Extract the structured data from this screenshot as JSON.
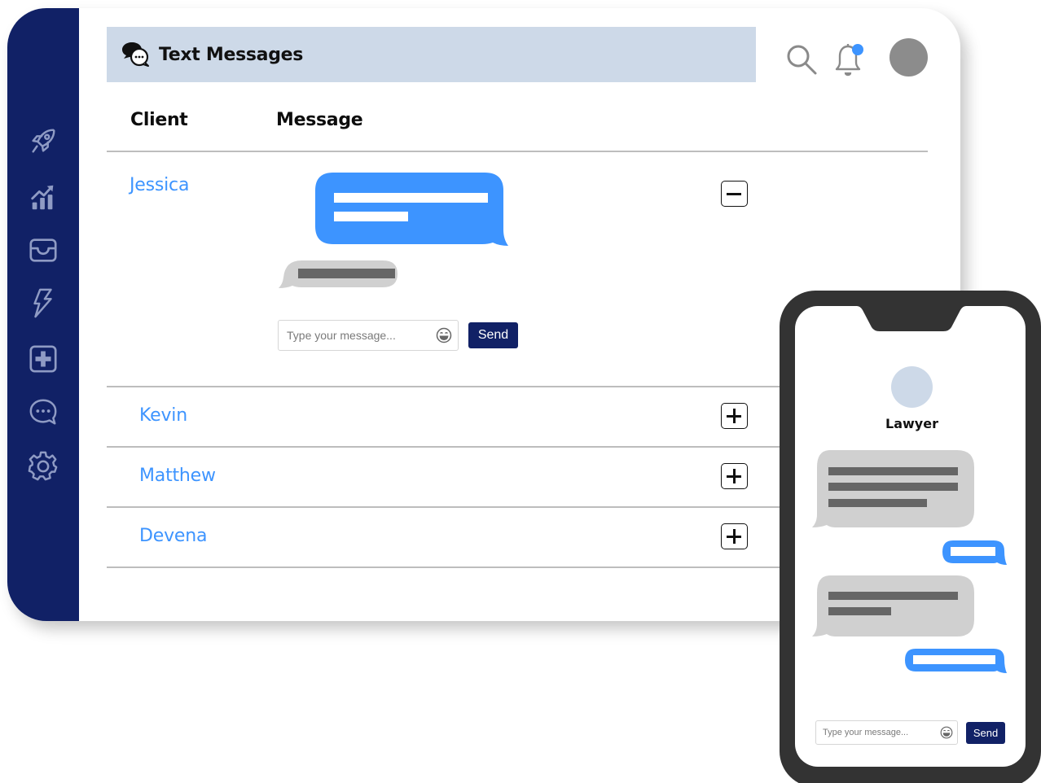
{
  "app": {
    "title": "Text Messages",
    "title_icon": "chat-bubbles-icon"
  },
  "header": {
    "search_icon": "search-icon",
    "notification_icon": "bell-icon",
    "notification_badge_color": "#3d94ff",
    "avatar_color": "#8c8c8c"
  },
  "sidebar": {
    "background": "#112166",
    "items": [
      {
        "name": "launch",
        "icon": "rocket-icon"
      },
      {
        "name": "analytics",
        "icon": "chart-growth-icon"
      },
      {
        "name": "inbox",
        "icon": "inbox-icon"
      },
      {
        "name": "automations",
        "icon": "lightning-icon"
      },
      {
        "name": "add",
        "icon": "plus-square-icon"
      },
      {
        "name": "messages",
        "icon": "chat-icon"
      },
      {
        "name": "settings",
        "icon": "gear-icon"
      }
    ]
  },
  "table": {
    "columns": [
      "Client",
      "Message"
    ],
    "rows": [
      {
        "client": "Jessica",
        "expanded": true,
        "toggle": "collapse"
      },
      {
        "client": "Kevin",
        "expanded": false,
        "toggle": "expand"
      },
      {
        "client": "Matthew",
        "expanded": false,
        "toggle": "expand"
      },
      {
        "client": "Devena",
        "expanded": false,
        "toggle": "expand"
      }
    ]
  },
  "conversation": {
    "input_placeholder": "Type your message...",
    "send_label": "Send",
    "outgoing_color": "#3d94ff",
    "incoming_color": "#d0d0d0"
  },
  "phone": {
    "contact_name": "Lawyer",
    "contact_avatar_color": "#cdd9e8",
    "input_placeholder": "Type your message...",
    "send_label": "Send"
  },
  "colors": {
    "accent": "#3d94ff",
    "navy": "#112166",
    "header_bg": "#cdd9e8",
    "phone_frame": "#333333"
  }
}
